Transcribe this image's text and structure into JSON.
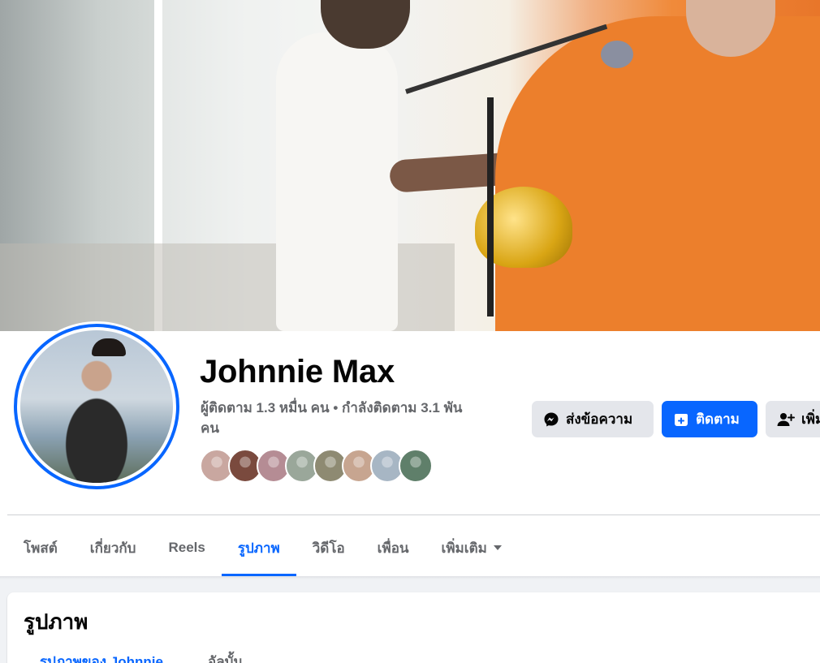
{
  "profile": {
    "name": "Johnnie Max",
    "followers_line": "ผู้ติดตาม 1.3 หมื่น คน • กำลังติดตาม 3.1 พัน คน"
  },
  "actions": {
    "message_label": "ส่งข้อความ",
    "follow_label": "ติดตาม",
    "add_friend_label": "เพิ่มเพื่อน"
  },
  "friend_avatars": [
    {
      "color": "#c9a7a0"
    },
    {
      "color": "#7a4a3e"
    },
    {
      "color": "#b58c94"
    },
    {
      "color": "#9aa79a"
    },
    {
      "color": "#8e8a72"
    },
    {
      "color": "#c7a590"
    },
    {
      "color": "#a7b6c4"
    },
    {
      "color": "#5f7f6a"
    }
  ],
  "tabs": [
    {
      "label": "โพสต์"
    },
    {
      "label": "เกี่ยวกับ"
    },
    {
      "label": "Reels"
    },
    {
      "label": "รูปภาพ",
      "active": true
    },
    {
      "label": "วิดีโอ"
    },
    {
      "label": "เพื่อน"
    },
    {
      "label": "เพิ่มเติม"
    }
  ],
  "photos_section": {
    "title": "รูปภาพ",
    "subtabs": [
      "รูปภาพของ Johnnie",
      "อัลบั้ม"
    ]
  },
  "colors": {
    "accent": "#0866ff",
    "secondary_text": "#65676b",
    "button_gray": "#e4e6eb"
  }
}
